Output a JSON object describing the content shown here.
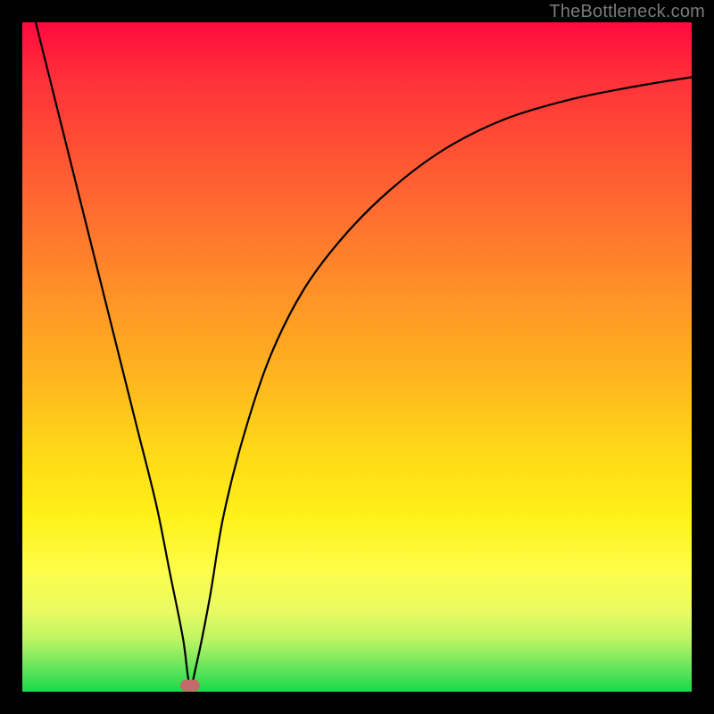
{
  "watermark": "TheBottleneck.com",
  "chart_data": {
    "type": "line",
    "title": "",
    "xlabel": "",
    "ylabel": "",
    "xlim": [
      0,
      100
    ],
    "ylim": [
      0,
      100
    ],
    "grid": false,
    "legend": false,
    "background_gradient": [
      "#ff0a3e",
      "#ff8a2a",
      "#fff119",
      "#18d94a"
    ],
    "series": [
      {
        "name": "bottleneck-curve",
        "x": [
          2,
          5,
          8,
          11,
          14,
          17,
          20,
          22,
          24,
          25,
          26,
          28,
          30,
          33,
          37,
          42,
          48,
          55,
          63,
          72,
          82,
          92,
          100
        ],
        "y": [
          100,
          88,
          76,
          64,
          52,
          40,
          28,
          18,
          8,
          1,
          4,
          14,
          26,
          38,
          50,
          60,
          68,
          75,
          81,
          85.5,
          88.5,
          90.5,
          91.8
        ]
      }
    ],
    "marker": {
      "x": 25,
      "y": 1,
      "color": "#c56a6a"
    }
  }
}
